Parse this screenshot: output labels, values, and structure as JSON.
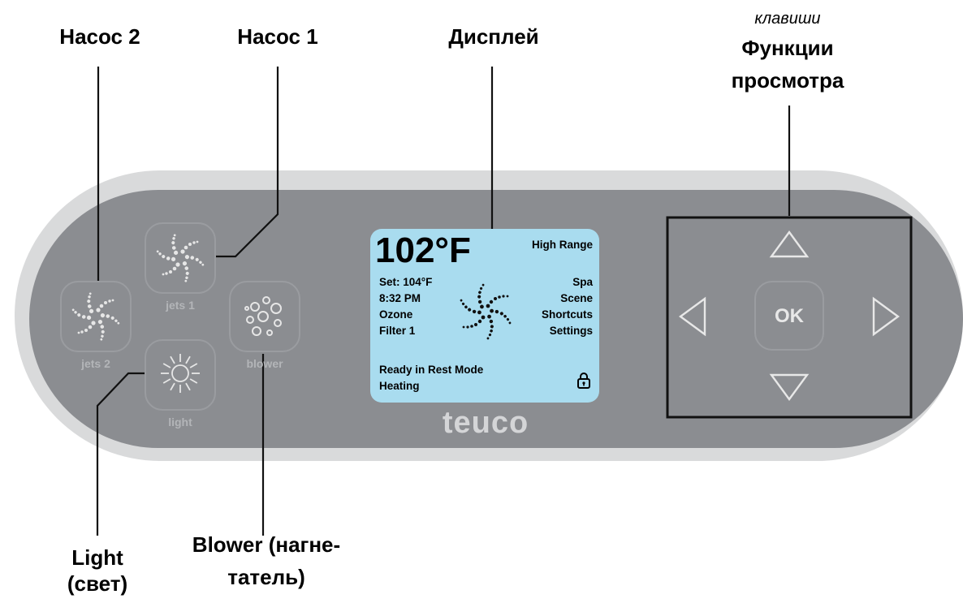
{
  "callouts": {
    "pump2": "Насос 2",
    "pump1": "Насос 1",
    "display": "Дисплей",
    "keys_italic": "клавиши",
    "view_functions_line1": "Функции",
    "view_functions_line2": "просмотра",
    "light_line1": "Light",
    "light_line2": "(свет)",
    "blower_line1": "Blower (нагне-",
    "blower_line2": "татель)"
  },
  "panel": {
    "brand": "teuco",
    "colors": {
      "outer": "#d9dadb",
      "inner": "#8b8d91",
      "lcd": "#a9dcef"
    }
  },
  "buttons": {
    "jets1": {
      "label": "jets 1",
      "icon": "jets-swirl-icon"
    },
    "jets2": {
      "label": "jets 2",
      "icon": "jets-swirl-icon"
    },
    "blower": {
      "label": "blower",
      "icon": "bubbles-icon"
    },
    "light": {
      "label": "light",
      "icon": "sun-icon"
    }
  },
  "display": {
    "temperature": "102°F",
    "range": "High Range",
    "set": "Set: 104°F",
    "time": "8:32 PM",
    "ozone": "Ozone",
    "filter": "Filter 1",
    "menu": [
      "Spa",
      "Scene",
      "Shortcuts",
      "Settings"
    ],
    "status1": "Ready in Rest Mode",
    "status2": "Heating",
    "lock_icon": "lock-icon"
  },
  "nav": {
    "ok_label": "OK",
    "up_icon": "arrow-up-icon",
    "down_icon": "arrow-down-icon",
    "left_icon": "arrow-left-icon",
    "right_icon": "arrow-right-icon"
  }
}
